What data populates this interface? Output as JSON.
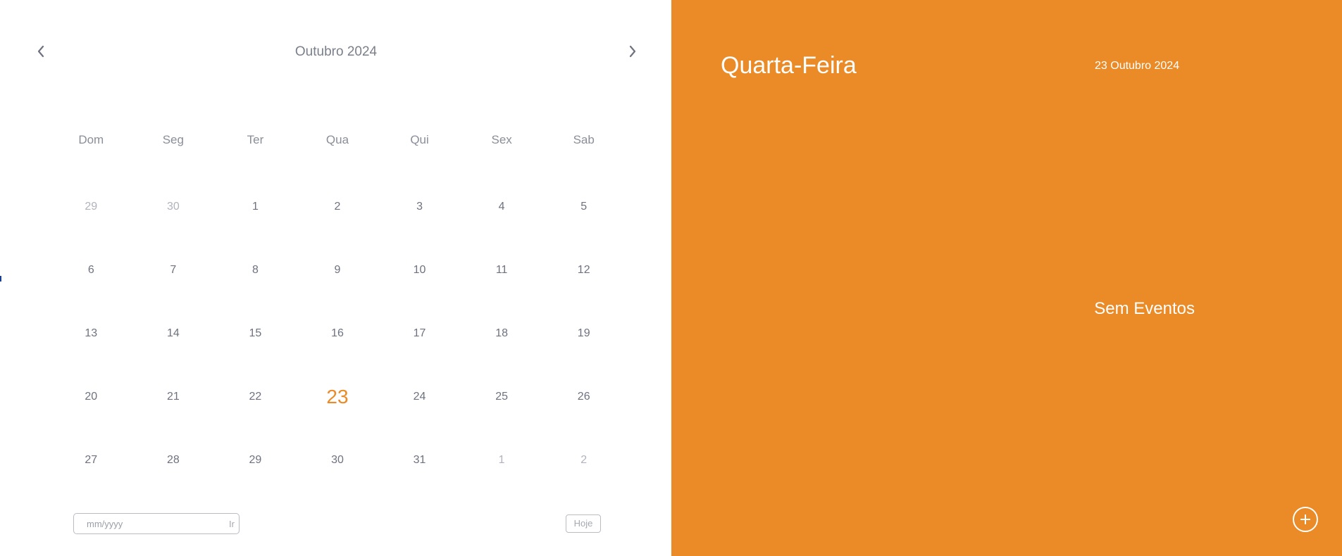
{
  "colors": {
    "accent": "#ea8b27",
    "text_muted": "#6e7280",
    "text_faded": "#b0b3bb",
    "panel_text": "#ffffff"
  },
  "calendar": {
    "month_title": "Outubro 2024",
    "prev_icon": "chevron-left-icon",
    "next_icon": "chevron-right-icon",
    "weekdays": [
      "Dom",
      "Seg",
      "Ter",
      "Qua",
      "Qui",
      "Sex",
      "Sab"
    ],
    "weeks": [
      [
        {
          "label": "29",
          "state": "other"
        },
        {
          "label": "30",
          "state": "other"
        },
        {
          "label": "1",
          "state": "current"
        },
        {
          "label": "2",
          "state": "current"
        },
        {
          "label": "3",
          "state": "current"
        },
        {
          "label": "4",
          "state": "current"
        },
        {
          "label": "5",
          "state": "current"
        }
      ],
      [
        {
          "label": "6",
          "state": "current"
        },
        {
          "label": "7",
          "state": "current"
        },
        {
          "label": "8",
          "state": "current"
        },
        {
          "label": "9",
          "state": "current"
        },
        {
          "label": "10",
          "state": "current"
        },
        {
          "label": "11",
          "state": "current"
        },
        {
          "label": "12",
          "state": "current"
        }
      ],
      [
        {
          "label": "13",
          "state": "current"
        },
        {
          "label": "14",
          "state": "current"
        },
        {
          "label": "15",
          "state": "current"
        },
        {
          "label": "16",
          "state": "current"
        },
        {
          "label": "17",
          "state": "current"
        },
        {
          "label": "18",
          "state": "current"
        },
        {
          "label": "19",
          "state": "current"
        }
      ],
      [
        {
          "label": "20",
          "state": "current"
        },
        {
          "label": "21",
          "state": "current"
        },
        {
          "label": "22",
          "state": "current"
        },
        {
          "label": "23",
          "state": "today"
        },
        {
          "label": "24",
          "state": "current"
        },
        {
          "label": "25",
          "state": "current"
        },
        {
          "label": "26",
          "state": "current"
        }
      ],
      [
        {
          "label": "27",
          "state": "current"
        },
        {
          "label": "28",
          "state": "current"
        },
        {
          "label": "29",
          "state": "current"
        },
        {
          "label": "30",
          "state": "current"
        },
        {
          "label": "31",
          "state": "current"
        },
        {
          "label": "1",
          "state": "other"
        },
        {
          "label": "2",
          "state": "other"
        }
      ]
    ],
    "goto": {
      "placeholder": "mm/yyyy",
      "value": "",
      "button_label": "Ir"
    },
    "today_button_label": "Hoje"
  },
  "events_panel": {
    "weekday": "Quarta-Feira",
    "date": "23 Outubro 2024",
    "empty_message": "Sem Eventos",
    "add_icon": "plus-circle-icon"
  }
}
